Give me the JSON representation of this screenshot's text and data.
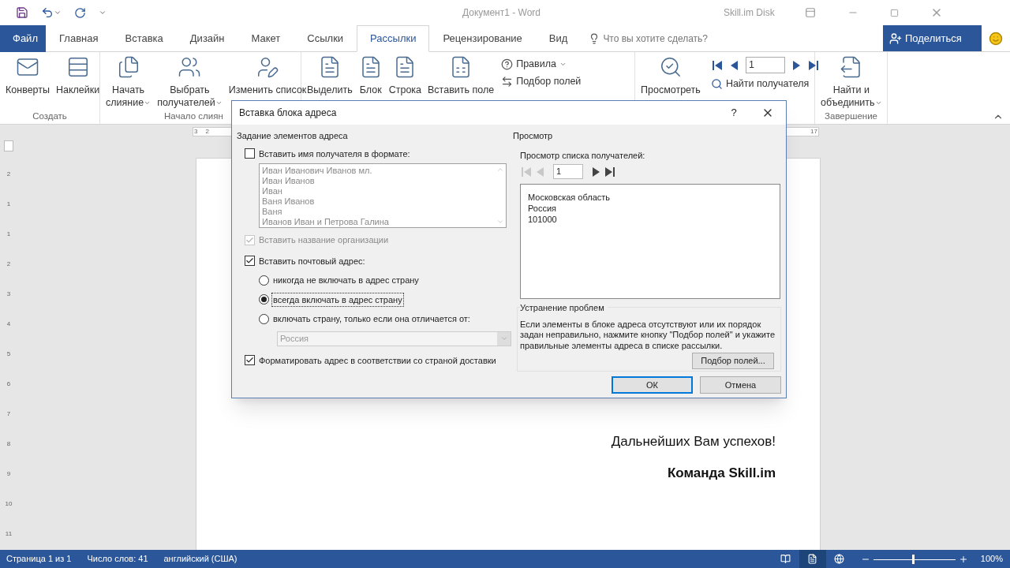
{
  "title_bar": {
    "document_title": "Документ1 - Word",
    "account": "Skill.im Disk"
  },
  "menu_tabs": [
    {
      "label": "Файл",
      "kind": "file",
      "selected": false
    },
    {
      "label": "Главная",
      "kind": "tab",
      "selected": false
    },
    {
      "label": "Вставка",
      "kind": "tab",
      "selected": false
    },
    {
      "label": "Дизайн",
      "kind": "tab",
      "selected": false
    },
    {
      "label": "Макет",
      "kind": "tab",
      "selected": false
    },
    {
      "label": "Ссылки",
      "kind": "tab",
      "selected": false
    },
    {
      "label": "Рассылки",
      "kind": "tab",
      "selected": true
    },
    {
      "label": "Рецензирование",
      "kind": "tab",
      "selected": false
    },
    {
      "label": "Вид",
      "kind": "tab",
      "selected": false
    }
  ],
  "tell_me": {
    "placeholder": "Что вы хотите сделать?"
  },
  "share_button": "Поделиться",
  "ribbon_groups": [
    {
      "label": "Создать",
      "buttons": [
        {
          "kind": "envelope",
          "lines": [
            "Конверты"
          ],
          "dropdown": false
        },
        {
          "kind": "labels",
          "lines": [
            "Наклейки"
          ],
          "dropdown": false
        }
      ]
    },
    {
      "label": "Начало слиян",
      "buttons": [
        {
          "kind": "merge",
          "lines": [
            "Начать",
            "слияние"
          ],
          "dropdown": true
        },
        {
          "kind": "recipients",
          "lines": [
            "Выбрать",
            "получателей"
          ],
          "dropdown": true
        },
        {
          "kind": "edit_list",
          "lines": [
            "Изменить список"
          ],
          "dropdown": false
        }
      ]
    },
    {
      "buttons": [
        {
          "kind": "highlight",
          "lines": [
            "Выделить"
          ],
          "dropdown": false
        },
        {
          "kind": "block",
          "lines": [
            "Блок"
          ],
          "dropdown": false
        },
        {
          "kind": "line",
          "lines": [
            "Строка"
          ],
          "dropdown": false
        },
        {
          "kind": "insert_field",
          "lines": [
            "Вставить поле"
          ],
          "dropdown": false
        }
      ],
      "small_buttons": [
        {
          "kind": "rules",
          "label": "Правила",
          "dropdown": true
        },
        {
          "kind": "match_fields",
          "label": "Подбор полей",
          "dropdown": false
        }
      ]
    },
    {
      "buttons": [
        {
          "kind": "preview",
          "lines": [
            "Просмотреть"
          ],
          "dropdown": false
        }
      ],
      "record_nav": {
        "record": "1",
        "find": "Найти получателя"
      }
    },
    {
      "label": "Завершение",
      "buttons": [
        {
          "kind": "finish",
          "lines": [
            "Найти и",
            "объединить"
          ],
          "dropdown": true
        }
      ]
    }
  ],
  "ruler": {
    "left_marks": [
      "3",
      "2"
    ],
    "right_mark": "17",
    "vertical_marks": [
      "2",
      "1",
      "1",
      "2",
      "3",
      "4",
      "5",
      "6",
      "7",
      "8",
      "9",
      "10",
      "11"
    ]
  },
  "document": {
    "closing": "Дальнейших Вам успехов!",
    "signature": "Команда Skill.im"
  },
  "dialog": {
    "title": "Вставка блока адреса",
    "help": "?",
    "address_elements": {
      "title": "Задание элементов адреса",
      "recipient_name": {
        "label": "Вставить имя получателя в формате:",
        "checked": false
      },
      "name_formats": [
        "Иван Иванович Иванов мл.",
        "Иван Иванов",
        "Иван",
        "Ваня Иванов",
        "Ваня",
        "Иванов Иван и Петрова Галина"
      ],
      "company_name": {
        "label": "Вставить название организации",
        "checked": true,
        "disabled": true
      },
      "postal_address": {
        "label": "Вставить почтовый адрес:",
        "checked": true
      },
      "country_options": [
        {
          "label": "никогда не включать в адрес страну",
          "selected": false
        },
        {
          "label": "всегда включать в адрес страну",
          "selected": true
        },
        {
          "label": "включать страну, только если она отличается от:",
          "selected": false
        }
      ],
      "country_select": {
        "value": "Россия",
        "disabled": true
      },
      "format_by_country": {
        "label": "Форматировать адрес в соответствии со страной доставки",
        "checked": true
      }
    },
    "preview": {
      "title": "Просмотр",
      "label": "Просмотр списка получателей:",
      "record": "1",
      "nav": [
        {
          "kind": "first",
          "disabled": true
        },
        {
          "kind": "prev",
          "disabled": true
        },
        {
          "kind": "next",
          "disabled": false
        },
        {
          "kind": "last",
          "disabled": false
        }
      ],
      "lines": [
        "Московская область",
        "Россия",
        "101000"
      ]
    },
    "troubleshoot": {
      "title": "Устранение проблем",
      "text": "Если элементы в блоке адреса отсутствуют или их порядок задан неправильно, нажмите кнопку \"Подбор полей\" и укажите правильные элементы адреса в списке рассылки.",
      "button": "Подбор полей..."
    },
    "buttons": [
      {
        "label": "ОК",
        "default": true
      },
      {
        "label": "Отмена",
        "default": false
      }
    ]
  },
  "status_bar": {
    "items": [
      "Страница 1 из 1",
      "Число слов: 41",
      "английский (США)"
    ],
    "views": [
      {
        "kind": "read",
        "selected": false
      },
      {
        "kind": "print",
        "selected": true
      },
      {
        "kind": "web",
        "selected": false
      }
    ],
    "zoom": {
      "level": 0.5,
      "label": "100%"
    }
  }
}
